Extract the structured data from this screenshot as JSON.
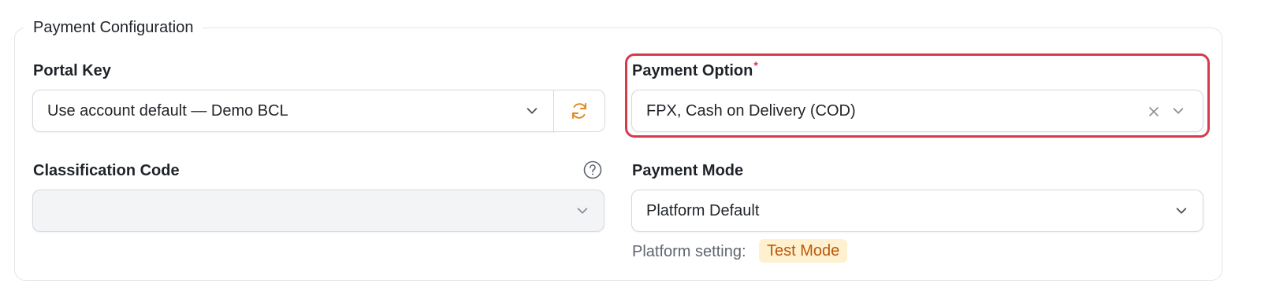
{
  "section": {
    "title": "Payment Configuration"
  },
  "portal_key": {
    "label": "Portal Key",
    "value": "Use account default — Demo BCL",
    "refresh_icon": "refresh-icon",
    "chevron_icon": "chevron-down-icon"
  },
  "payment_option": {
    "label": "Payment Option",
    "required_mark": "*",
    "value": "FPX, Cash on Delivery (COD)",
    "clear_icon": "close-icon",
    "chevron_icon": "chevron-down-icon",
    "highlight_color": "#d43b4b"
  },
  "classification_code": {
    "label": "Classification Code",
    "value": "",
    "help_icon": "help-circle-icon",
    "disabled": true
  },
  "payment_mode": {
    "label": "Payment Mode",
    "value": "Platform Default",
    "hint_label": "Platform setting:",
    "badge": "Test Mode",
    "badge_bg": "#fff1cf",
    "badge_color": "#b9580a"
  },
  "colors": {
    "accent": "#e08a1e",
    "required": "#e0314b"
  }
}
